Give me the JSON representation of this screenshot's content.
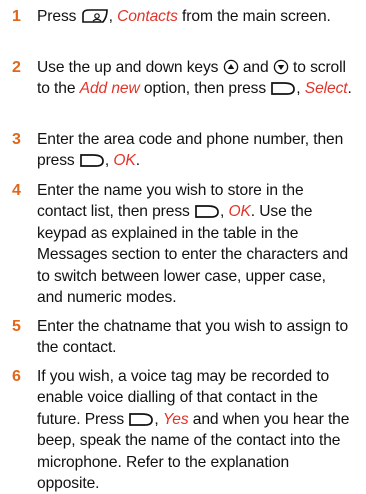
{
  "steps": [
    {
      "number": "1",
      "parts": [
        {
          "t": "text",
          "v": "Press "
        },
        {
          "t": "icon",
          "name": "contacts-key-icon"
        },
        {
          "t": "text",
          "v": ", "
        },
        {
          "t": "red",
          "v": "Contacts"
        },
        {
          "t": "text",
          "v": " from the main screen."
        }
      ]
    },
    {
      "number": "2",
      "parts": [
        {
          "t": "text",
          "v": "Use the up and down keys "
        },
        {
          "t": "icon",
          "name": "up-key-icon"
        },
        {
          "t": "text",
          "v": " and "
        },
        {
          "t": "icon",
          "name": "down-key-icon"
        },
        {
          "t": "text",
          "v": " to scroll to the "
        },
        {
          "t": "red",
          "v": "Add new"
        },
        {
          "t": "text",
          "v": " option, then press "
        },
        {
          "t": "icon",
          "name": "right-softkey-icon"
        },
        {
          "t": "text",
          "v": ", "
        },
        {
          "t": "red",
          "v": "Select"
        },
        {
          "t": "text",
          "v": "."
        }
      ]
    },
    {
      "number": "3",
      "parts": [
        {
          "t": "text",
          "v": "Enter the area code and phone number, then press "
        },
        {
          "t": "icon",
          "name": "right-softkey-icon"
        },
        {
          "t": "text",
          "v": ", "
        },
        {
          "t": "red",
          "v": "OK"
        },
        {
          "t": "text",
          "v": "."
        }
      ]
    },
    {
      "number": "4",
      "parts": [
        {
          "t": "text",
          "v": "Enter the name you wish to store in the contact list, then press "
        },
        {
          "t": "icon",
          "name": "right-softkey-icon"
        },
        {
          "t": "text",
          "v": ", "
        },
        {
          "t": "red",
          "v": "OK"
        },
        {
          "t": "text",
          "v": ". Use the keypad as explained in the table in the Messages section to enter the characters and to switch between lower case, upper case, and numeric modes."
        }
      ]
    },
    {
      "number": "5",
      "parts": [
        {
          "t": "text",
          "v": "Enter the chatname that you wish to assign to the contact."
        }
      ]
    },
    {
      "number": "6",
      "parts": [
        {
          "t": "text",
          "v": "If you wish, a voice tag may be recorded to enable voice dialling of that contact in the future. Press "
        },
        {
          "t": "icon",
          "name": "right-softkey-icon"
        },
        {
          "t": "text",
          "v": ", "
        },
        {
          "t": "red",
          "v": "Yes"
        },
        {
          "t": "text",
          "v": " and when you hear the beep, speak the name of the contact into the microphone. Refer to the explanation opposite."
        }
      ]
    }
  ]
}
